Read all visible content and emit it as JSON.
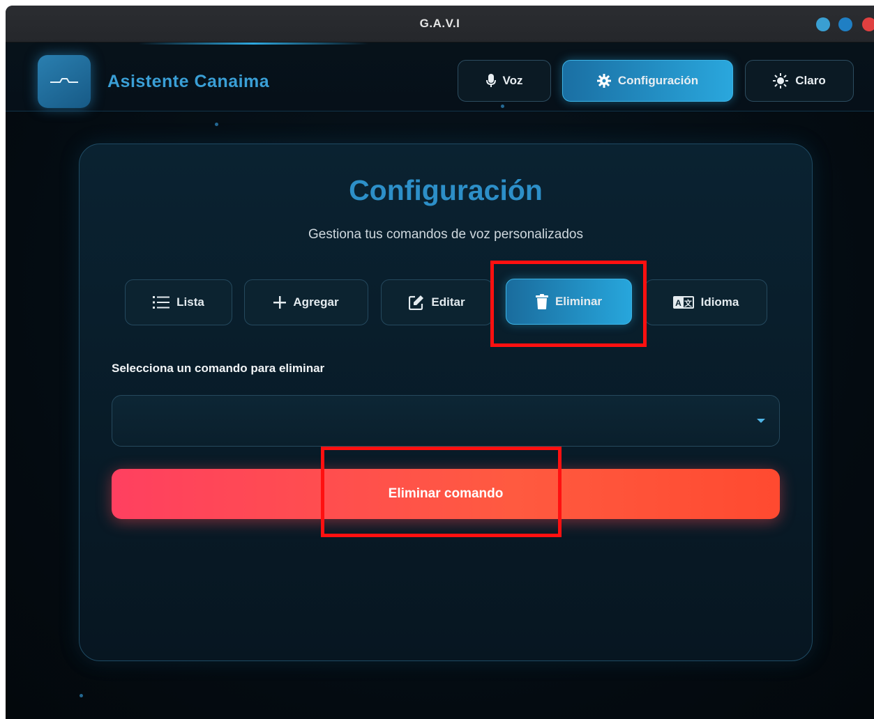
{
  "window": {
    "title": "G.A.V.I"
  },
  "header": {
    "brand": "Asistente Canaima",
    "buttons": {
      "voz": "Voz",
      "config": "Configuración",
      "claro": "Claro"
    }
  },
  "card": {
    "title": "Configuración",
    "subtitle": "Gestiona tus comandos de voz personalizados",
    "tabs": [
      {
        "label": "Lista",
        "icon": "list-icon"
      },
      {
        "label": "Agregar",
        "icon": "plus-icon"
      },
      {
        "label": "Editar",
        "icon": "edit-icon"
      },
      {
        "label": "Eliminar",
        "icon": "trash-icon",
        "active": true
      },
      {
        "label": "Idioma",
        "icon": "language-icon"
      }
    ],
    "select_label": "Selecciona un comando para eliminar",
    "select_value": "",
    "delete_button": "Eliminar comando"
  },
  "colors": {
    "accent": "#2aa7dd",
    "brand": "#3a9fd6",
    "danger_start": "#ff4060",
    "danger_end": "#ff4a30",
    "annotation": "#ff1010"
  }
}
